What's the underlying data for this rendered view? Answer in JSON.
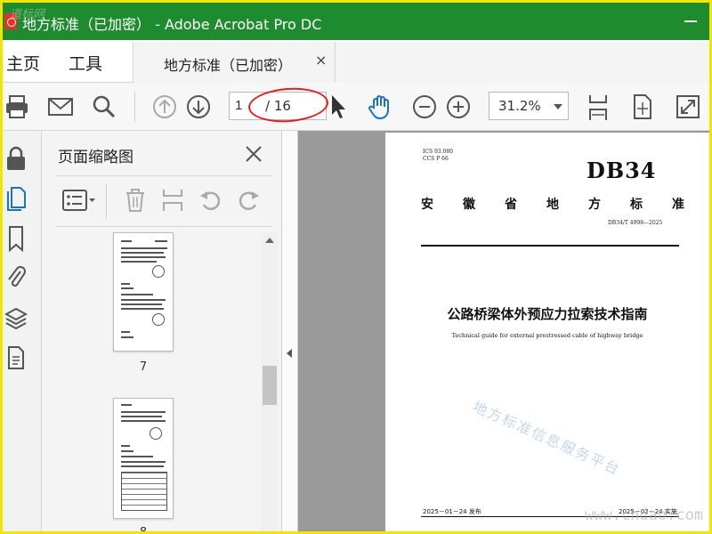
{
  "window": {
    "title": "地方标准（已加密） - Adobe Acrobat Pro DC",
    "corner_watermark": "道标网"
  },
  "menu": {
    "home": "主页",
    "tools": "工具",
    "doc_tab": "地方标准（已加密）",
    "doc_tab_close": "×"
  },
  "toolbar": {
    "current_page": "1",
    "page_total": "/ 16",
    "zoom": "31.2%",
    "icons": [
      "print-icon",
      "email-icon",
      "search-icon",
      "previous-page-icon",
      "next-page-icon",
      "select-cursor-icon",
      "hand-tool-icon",
      "zoom-out-icon",
      "zoom-in-icon",
      "fit-page-icon",
      "page-scroll-icon",
      "full-screen-icon"
    ]
  },
  "rail": {
    "icons": [
      "lock-icon",
      "pages-icon",
      "bookmark-icon",
      "attachment-icon",
      "layers-icon",
      "document-icon"
    ]
  },
  "thumbnails": {
    "title": "页面缩略图",
    "pages": [
      {
        "number": "7"
      },
      {
        "number": "8"
      }
    ]
  },
  "document": {
    "ics": "ICS  93.080",
    "ccs": "CCS  P 66",
    "code": "DB34",
    "province": "安徽省地方标准",
    "std_number": "DB34/T 4998—2025",
    "title_cn": "公路桥梁体外预应力拉索技术指南",
    "title_en": "Technical guide for external prestressed cable of highway bridge",
    "watermark": "地方标准信息服务平台",
    "issue": "2025－01－24 发布",
    "implement": "2025－02－24 实施"
  },
  "site_watermark": "www.cndao.com",
  "colors": {
    "titlebar": "#1e8b2e",
    "frame": "#f2e600",
    "annotation": "#e02020",
    "hand_tool": "#1a73c9"
  }
}
